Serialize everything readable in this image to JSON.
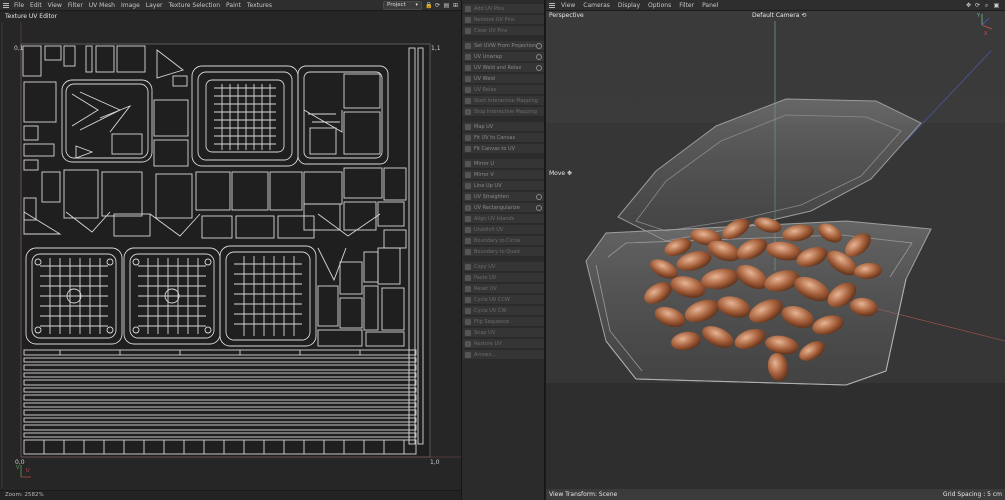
{
  "editor": {
    "menu_items": [
      "File",
      "Edit",
      "View",
      "Filter",
      "UV Mesh",
      "Image",
      "Layer",
      "Texture Selection",
      "Paint",
      "Textures"
    ],
    "project_select": "Project",
    "title": "Texture UV Editor",
    "corner_labels": {
      "top_left": "0,1",
      "top_right": "1,1",
      "bottom_left": "0,0",
      "bottom_right": "1,0"
    },
    "axis_labels": {
      "u": "U",
      "v": "V"
    },
    "zoom": "Zoom: 2582%"
  },
  "commands": [
    {
      "label": "Add UV Pins",
      "gear": false
    },
    {
      "label": "Remove UV Pins",
      "gear": false
    },
    {
      "label": "Clear UV Pins",
      "gear": false
    },
    {
      "label": "Set UVW From Projection",
      "gear": true
    },
    {
      "label": "UV Unwrap",
      "gear": true
    },
    {
      "label": "UV Weld and Relax",
      "gear": true
    },
    {
      "label": "UV Weld",
      "gear": false
    },
    {
      "label": "UV Relax",
      "gear": false
    },
    {
      "label": "Start Interactive Mapping",
      "gear": false
    },
    {
      "label": "Stop Interactive Mapping",
      "gear": false
    },
    {
      "label": "Map UV",
      "gear": false
    },
    {
      "label": "Fit UV to Canvas",
      "gear": false
    },
    {
      "label": "Fit Canvas to UV",
      "gear": false
    },
    {
      "label": "Mirror U",
      "gear": false
    },
    {
      "label": "Mirror V",
      "gear": false
    },
    {
      "label": "Line Up UV",
      "gear": false
    },
    {
      "label": "UV Straighten",
      "gear": true
    },
    {
      "label": "UV Rectangularize",
      "gear": true
    },
    {
      "label": "Align UV Islands",
      "gear": false
    },
    {
      "label": "Unstitch UV",
      "gear": false
    },
    {
      "label": "Boundary to Circle",
      "gear": false
    },
    {
      "label": "Boundary to Quad",
      "gear": false
    },
    {
      "label": "Copy UV",
      "gear": false
    },
    {
      "label": "Paste UV",
      "gear": false
    },
    {
      "label": "Reset UV",
      "gear": false
    },
    {
      "label": "Cycle UV CCW",
      "gear": false
    },
    {
      "label": "Cycle UV CW",
      "gear": false
    },
    {
      "label": "Flip Sequence",
      "gear": false
    },
    {
      "label": "Snap UV",
      "gear": false
    },
    {
      "label": "Restore UV",
      "gear": false
    },
    {
      "label": "Arrows...",
      "gear": false
    }
  ],
  "viewport": {
    "menu_items": [
      "View",
      "Cameras",
      "Display",
      "Options",
      "Filter",
      "Panel"
    ],
    "projection": "Perspective",
    "camera": "Default Camera",
    "tool": "Move",
    "axis_labels": {
      "y": "Y",
      "x": "X"
    },
    "status_left": "View Transform: Scene",
    "status_right": "Grid Spacing : 5 cm"
  }
}
